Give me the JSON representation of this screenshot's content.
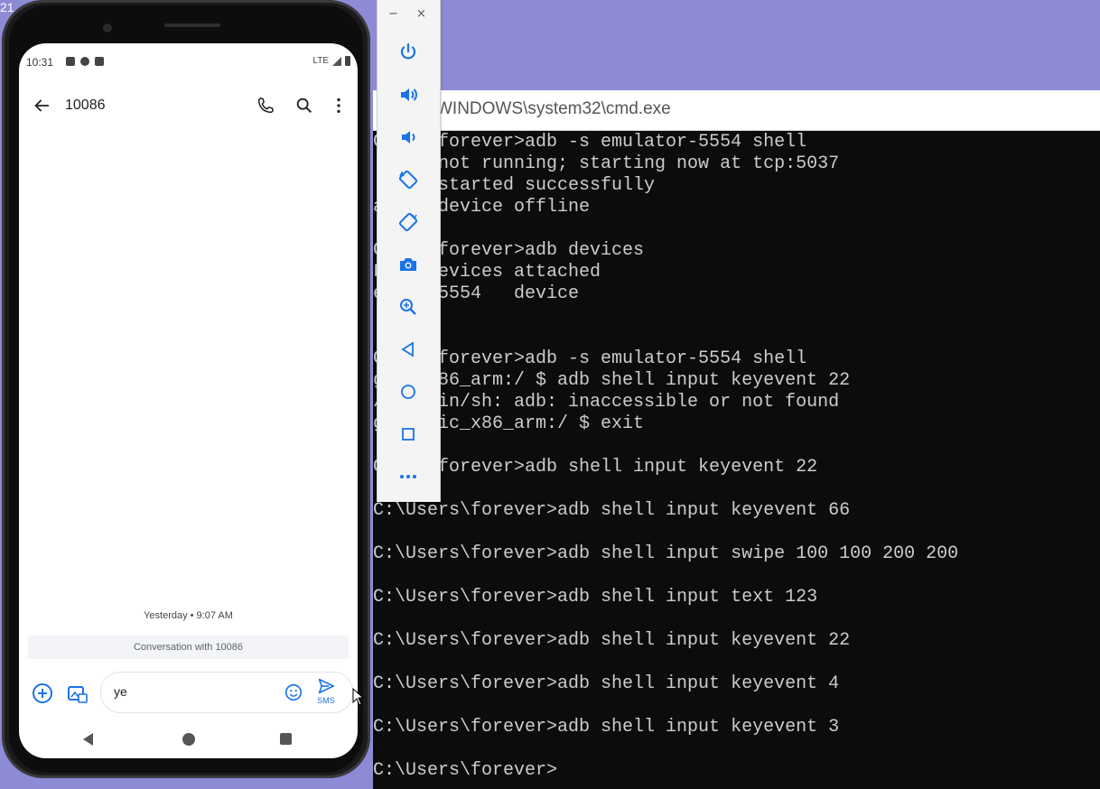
{
  "corner_fragment": "21",
  "cmd": {
    "title": "WINDOWS\\system32\\cmd.exe",
    "lines": [
      "C  rs\\forever>adb -s emulator-5554 shell",
      "   on not running; starting now at tcp:5037",
      "   on started successfully",
      "a  e: device offline",
      "",
      "C  rs\\forever>adb devices",
      "L  f devices attached",
      "e  or-5554   device",
      "",
      "",
      "C  rs\\forever>adb -s emulator-5554 shell",
      "g  c_x86_arm:/ $ adb shell input keyevent 22",
      "/  m/bin/sh: adb: inaccessible or not found",
      "g  neric_x86_arm:/ $ exit",
      "",
      "C  rs\\forever>adb shell input keyevent 22",
      "",
      "C:\\Users\\forever>adb shell input keyevent 66",
      "",
      "C:\\Users\\forever>adb shell input swipe 100 100 200 200",
      "",
      "C:\\Users\\forever>adb shell input text 123",
      "",
      "C:\\Users\\forever>adb shell input keyevent 22",
      "",
      "C:\\Users\\forever>adb shell input keyevent 4",
      "",
      "C:\\Users\\forever>adb shell input keyevent 3",
      "",
      "C:\\Users\\forever>"
    ]
  },
  "toolbar": {
    "minimize": "−",
    "close": "×",
    "buttons": [
      {
        "name": "power-button",
        "icon": "power-icon"
      },
      {
        "name": "volume-up-button",
        "icon": "volume-up-icon"
      },
      {
        "name": "volume-down-button",
        "icon": "volume-down-icon"
      },
      {
        "name": "rotate-left-button",
        "icon": "rotate-left-icon"
      },
      {
        "name": "rotate-right-button",
        "icon": "rotate-right-icon"
      },
      {
        "name": "screenshot-button",
        "icon": "camera-icon"
      },
      {
        "name": "zoom-button",
        "icon": "zoom-icon"
      },
      {
        "name": "back-button",
        "icon": "triangle-back-icon"
      },
      {
        "name": "home-button",
        "icon": "circle-home-icon"
      },
      {
        "name": "overview-button",
        "icon": "square-overview-icon"
      },
      {
        "name": "more-button",
        "icon": "more-dots-icon"
      }
    ]
  },
  "phone": {
    "status": {
      "time": "10:31",
      "network": "LTE"
    },
    "appbar": {
      "contact": "10086"
    },
    "timestamp": "Yesterday • 9:07 AM",
    "banner": "Conversation with 10086",
    "compose": {
      "text": "ye",
      "send_label": "SMS"
    },
    "colors": {
      "accent": "#1a73e8"
    }
  }
}
